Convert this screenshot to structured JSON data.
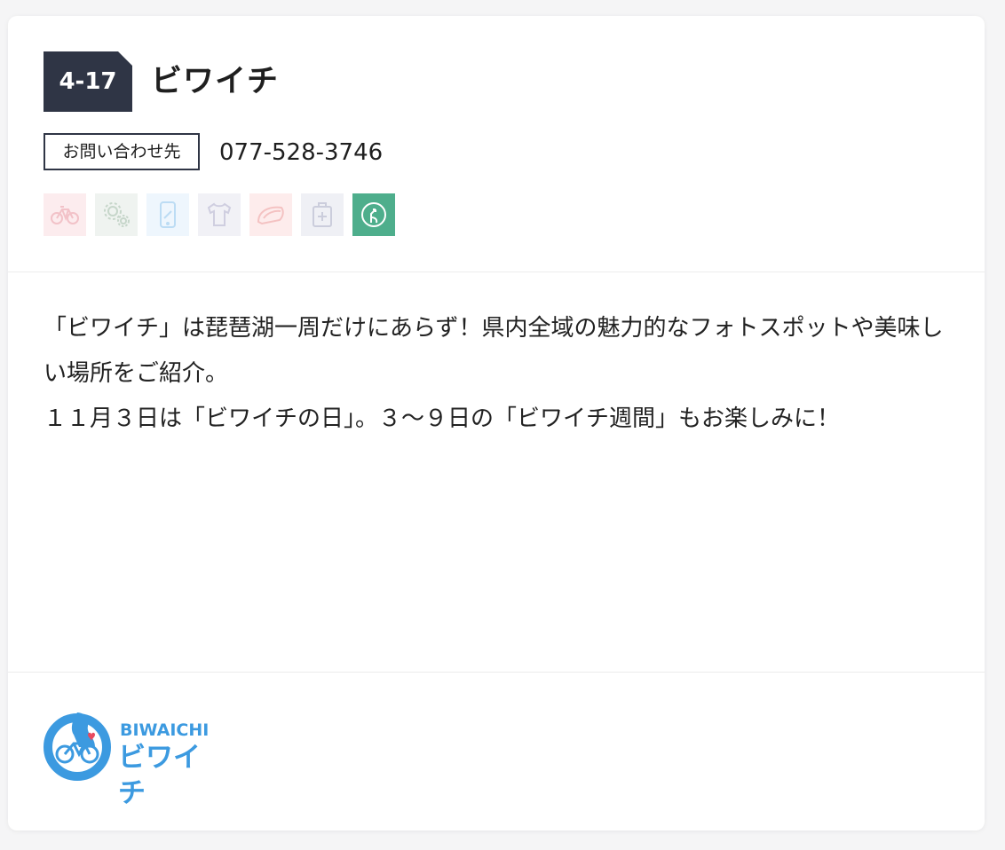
{
  "entry": {
    "number": "4-17",
    "title": "ビワイチ"
  },
  "contact": {
    "label": "お問い合わせ先",
    "phone": "077-528-3746"
  },
  "service_icons": [
    {
      "name": "bicycle-icon",
      "active": false,
      "color": "#e8a0a8"
    },
    {
      "name": "gears-icon",
      "active": false,
      "color": "#9cb8a4"
    },
    {
      "name": "smartphone-icon",
      "active": false,
      "color": "#9cc6ea"
    },
    {
      "name": "shirt-icon",
      "active": false,
      "color": "#aaa8c2"
    },
    {
      "name": "helmet-icon",
      "active": false,
      "color": "#eb9c9c"
    },
    {
      "name": "first-aid-icon",
      "active": false,
      "color": "#a6aac0"
    },
    {
      "name": "route-sign-icon",
      "active": true,
      "color": "#4eae8c"
    }
  ],
  "description": {
    "lines": [
      "「ビワイチ」は琵琶湖一周だけにあらず！県内全域の魅力的なフォトスポットや美味しい場所をご紹介。",
      "１１月３日は「ビワイチの日」。３〜９日の「ビワイチ週間」もお楽しみに！"
    ]
  },
  "logo": {
    "text_en": "BIWAICHI",
    "text_jp": "ビワイチ",
    "ring_text": "BIWAICHI",
    "color": "#3c9ae0"
  }
}
